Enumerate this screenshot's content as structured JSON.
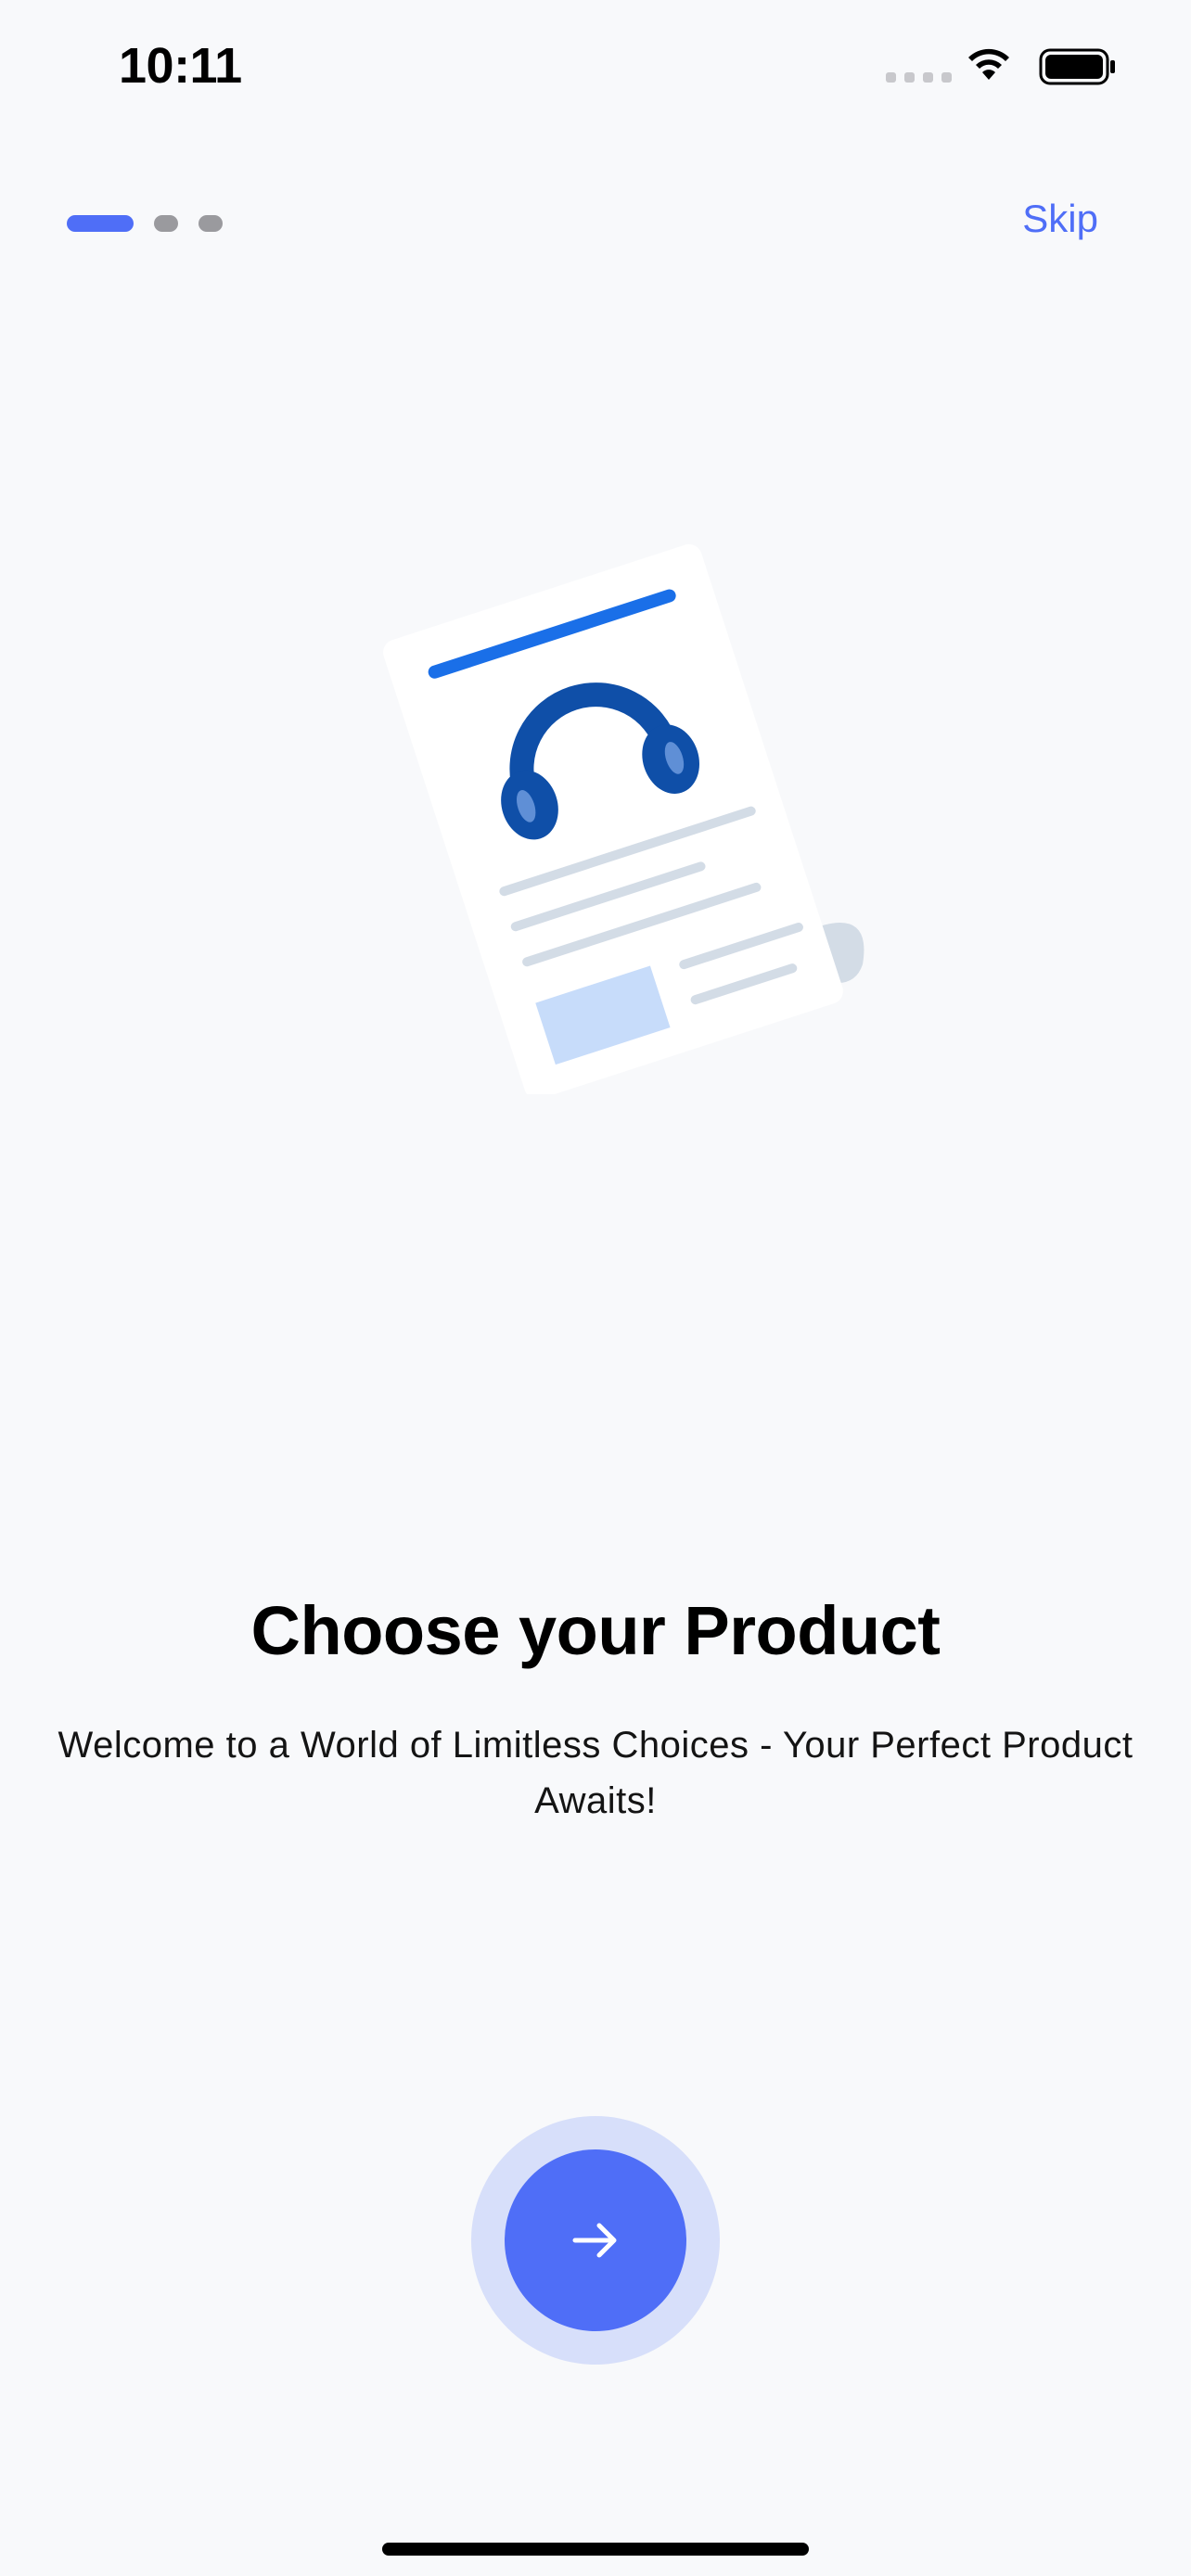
{
  "status_bar": {
    "time": "10:11",
    "icons": [
      "signal-icon",
      "wifi-icon",
      "battery-icon"
    ]
  },
  "onboarding": {
    "page_indicator": {
      "total": 3,
      "current": 1
    },
    "skip_label": "Skip",
    "title": "Choose your Product",
    "subtitle": "Welcome to a World of Limitless Choices - Your Perfect Product Awaits!",
    "illustration": "document-with-headphones-illustration",
    "next_button_icon": "arrow-right-icon"
  },
  "colors": {
    "accent": "#4f6ef7",
    "accent_light": "#d7dffa",
    "background": "#f8f9fb",
    "illustration_blue": "#0f4fa8",
    "illustration_bar": "#1a6fe8"
  }
}
